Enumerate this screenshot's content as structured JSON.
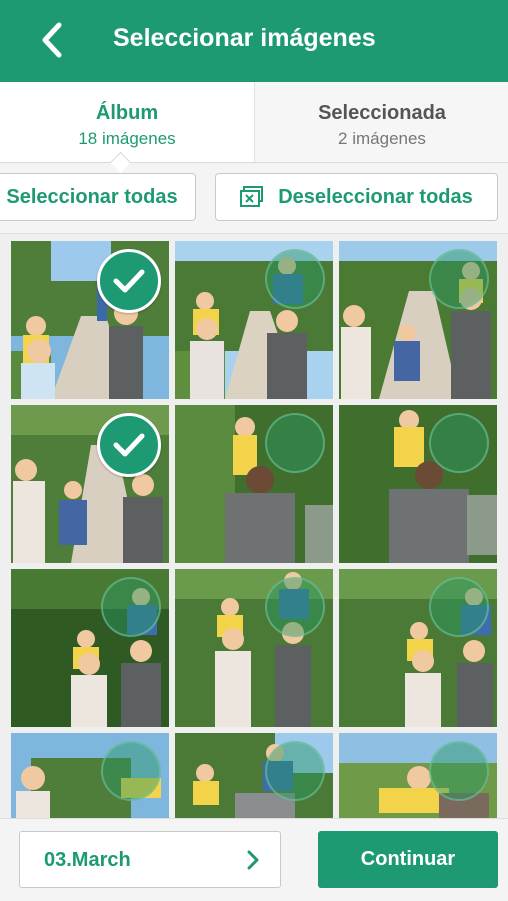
{
  "header": {
    "title": "Seleccionar imágenes"
  },
  "tabs": [
    {
      "label": "Álbum",
      "count": "18 imágenes"
    },
    {
      "label": "Seleccionada",
      "count": "2 imágenes"
    }
  ],
  "actions": {
    "select_all": "Seleccionar todas",
    "deselect_all": "Deseleccionar todas"
  },
  "photos": [
    {
      "selected": true
    },
    {
      "selected": false
    },
    {
      "selected": false
    },
    {
      "selected": true
    },
    {
      "selected": false
    },
    {
      "selected": false
    },
    {
      "selected": false
    },
    {
      "selected": false
    },
    {
      "selected": false
    },
    {
      "selected": false
    },
    {
      "selected": false
    },
    {
      "selected": false
    }
  ],
  "footer": {
    "date": "03.March",
    "continue": "Continuar"
  },
  "colors": {
    "accent": "#1d9a74"
  },
  "icons": {
    "back": "chevron-left-icon",
    "deselect": "deselect-images-icon",
    "check": "check-icon",
    "next": "chevron-right-icon"
  }
}
